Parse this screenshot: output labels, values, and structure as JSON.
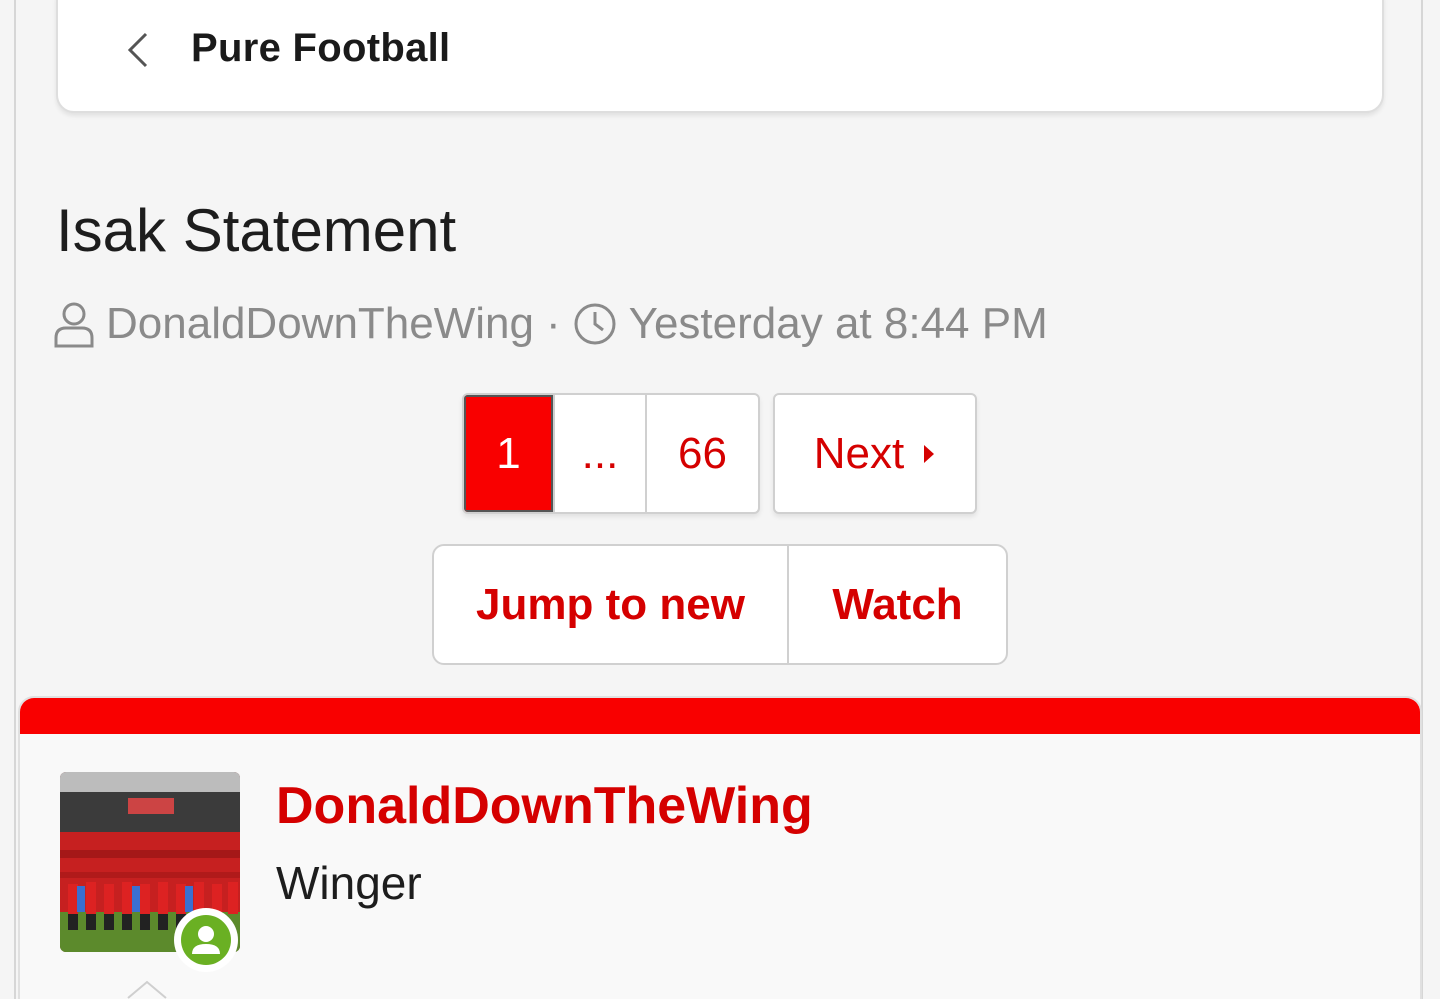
{
  "breadcrumb": {
    "title": "Pure Football",
    "back_icon": "chevron-left-icon"
  },
  "thread": {
    "title": "Isak Statement",
    "author": "DonaldDownTheWing",
    "separator": "·",
    "timestamp": "Yesterday at 8:44 PM"
  },
  "pagination": {
    "pages": [
      "1",
      "...",
      "66"
    ],
    "current": "1",
    "next_label": "Next"
  },
  "actions": {
    "jump_label": "Jump to new",
    "watch_label": "Watch"
  },
  "post": {
    "username": "DonaldDownTheWing",
    "role": "Winger"
  },
  "colors": {
    "accent": "#f90000",
    "link": "#d50000",
    "online": "#6ab023"
  }
}
